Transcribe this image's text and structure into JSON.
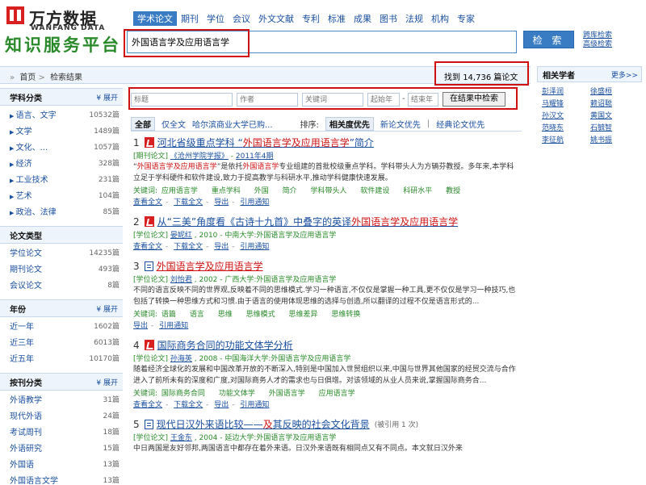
{
  "header": {
    "logo_cn": "万方数据",
    "logo_en": "WANFANG DATA",
    "platform": "知识服务平台",
    "nav": [
      {
        "label": "学术论文",
        "active": true
      },
      {
        "label": "期刊"
      },
      {
        "label": "学位"
      },
      {
        "label": "会议"
      },
      {
        "label": "外文文献"
      },
      {
        "label": "专利"
      },
      {
        "label": "标准"
      },
      {
        "label": "成果"
      },
      {
        "label": "图书"
      },
      {
        "label": "法规"
      },
      {
        "label": "机构"
      },
      {
        "label": "专家"
      }
    ],
    "search_value": "外国语言学及应用语言学",
    "search_button": "检 索",
    "links": [
      "跨库检索",
      "高级检索"
    ]
  },
  "breadcrumb": {
    "home": "首页",
    "current": "检索结果"
  },
  "found": {
    "prefix": "找到",
    "count": "14,736",
    "suffix": "篇论文"
  },
  "sidebar": {
    "subject": {
      "title": "学科分类",
      "expand": "展开",
      "items": [
        {
          "label": "语言、文字",
          "count": "10532篇"
        },
        {
          "label": "文学",
          "count": "1489篇"
        },
        {
          "label": "文化、...",
          "count": "1057篇"
        },
        {
          "label": "经济",
          "count": "328篇"
        },
        {
          "label": "工业技术",
          "count": "231篇"
        },
        {
          "label": "艺术",
          "count": "104篇"
        },
        {
          "label": "政治、法律",
          "count": "85篇"
        }
      ]
    },
    "type": {
      "title": "论文类型",
      "items": [
        {
          "label": "学位论文",
          "count": "14235篇"
        },
        {
          "label": "期刊论文",
          "count": "493篇"
        },
        {
          "label": "会议论文",
          "count": "8篇"
        }
      ]
    },
    "year": {
      "title": "年份",
      "expand": "展开",
      "items": [
        {
          "label": "近一年",
          "count": "1602篇"
        },
        {
          "label": "近三年",
          "count": "6013篇"
        },
        {
          "label": "近五年",
          "count": "10170篇"
        }
      ]
    },
    "journal": {
      "title": "按刊分类",
      "expand": "展开",
      "items": [
        {
          "label": "外语教学",
          "count": "31篇"
        },
        {
          "label": "现代外语",
          "count": "24篇"
        },
        {
          "label": "考试周刊",
          "count": "18篇"
        },
        {
          "label": "外语研究",
          "count": "15篇"
        },
        {
          "label": "外国语",
          "count": "13篇"
        },
        {
          "label": "外国语言文学",
          "count": "13篇"
        }
      ]
    }
  },
  "filter": {
    "title_ph": "标题",
    "author_ph": "作者",
    "keyword_ph": "关键词",
    "start_ph": "起始年",
    "end_ph": "结束年",
    "dash": "-",
    "button": "在结果中检索"
  },
  "sort": {
    "all": "全部",
    "fulltext": "仅全文",
    "school": "哈尔滨商业大学已购...",
    "label": "排序:",
    "relevance": "相关度优先",
    "new": "新论文优先",
    "pipe": "|",
    "classic": "经典论文优先"
  },
  "results": [
    {
      "num": "1",
      "title_pre": "河北省级重点学科 “",
      "title_hl": "外国语言学及应用语言学",
      "title_post": "”简介",
      "meta_type": "[期刊论文]",
      "meta_journal": "《沧州学院学报》",
      "meta_sep": " - ",
      "meta_issue": "2011年4期",
      "abstract_pre": "“",
      "abstract_hl1": "外国语言学及应用语言学",
      "abstract_mid": "”是依托",
      "abstract_hl2": "外国语言学",
      "abstract_post": "专业组建的首批校级重点学科。学科带头人为方辆芬教授。多年来,本学科立足于学科硬件和软件建设,致力于提高教学与科研水平,推动学科健康快速发展。",
      "kw_label": "关键词:",
      "keywords": [
        "应用语言学",
        "重点学科",
        "外国",
        "简介",
        "学科带头人",
        "软件建设",
        "科研水平",
        "教授"
      ],
      "actions": [
        "查看全文",
        "下载全文",
        "导出",
        "引用通知"
      ]
    },
    {
      "num": "2",
      "title_pre": "从“三美”角度看《古诗十九首》中叠字的英译",
      "title_hl": "外国语言学及应用语言学",
      "title_post": "",
      "meta_type": "[学位论文]",
      "meta_author": "晏妮红",
      "meta_rest": " ,  2010 - 中南大学:外国语言学及应用语言学",
      "actions": [
        "查看全文",
        "下载全文",
        "导出",
        "引用通知"
      ]
    },
    {
      "num": "3",
      "title_hl": "外国语言学及应用语言学",
      "meta_type": "[学位论文]",
      "meta_author": "刘怡君",
      "meta_rest": " ,  2002 - 广西大学:外国语言学及应用语言学",
      "abstract": "不同的语言反映不同的世界观,反映着不同的思维模式.学习一种语言,不仅仅是掌握一种工具,更不仅仅是学习一种技巧,也包括了转换一种思维方式和习惯.由于语言的使用体现思维的选择与创造,所以翻译的过程不仅是语言形式的...",
      "kw_label": "关键词:",
      "keywords": [
        "语篇",
        "语言",
        "思维",
        "思维模式",
        "思维差异",
        "思维转换"
      ],
      "actions": [
        "导出",
        "引用通知"
      ]
    },
    {
      "num": "4",
      "title": "国际商务合同的功能文体学分析",
      "meta_type": "[学位论文]",
      "meta_author": "孙海英",
      "meta_rest": " ,  2008 - 中国海洋大学:外国语言学及应用语言学",
      "abstract": "随着经济全球化的发展和中国改革开放的不断深入,特别是中国加入世贸组织以来,中国与世界其他国家的经贸交流与合作进入了前所未有的深度和广度,对国际商务人才的需求也与日俱增。对该领域的从业人员来说,掌握国际商务合...",
      "kw_label": "关键词:",
      "keywords": [
        "国际商务合同",
        "功能文体学",
        "外国语言学",
        "应用语言学"
      ],
      "actions": [
        "查看全文",
        "下载全文",
        "导出",
        "引用通知"
      ]
    },
    {
      "num": "5",
      "title_pre": "现代日汉外来语比较——",
      "title_hl": "及",
      "title_post": "其反映的社会文化背景",
      "cite": "(被引用 1 次)",
      "meta_type": "[学位论文]",
      "meta_author": "王金东",
      "meta_rest": " ,  2004 - 延边大学:外国语言学及应用语言学",
      "abstract": "中日两国是友好邻邦,两国语言中都存在着外来语。日汉外来语既有相同点又有不同点。本文就日汉外来"
    }
  ],
  "scholars": {
    "title": "相关学者",
    "more": "更多>>",
    "names": [
      "彭泽润",
      "徐盛桓",
      "马耀锋",
      "赖诏聪",
      "孙汉文",
      "黄国文",
      "范晓东",
      "石毓智",
      "李征航",
      "姚书振"
    ]
  }
}
